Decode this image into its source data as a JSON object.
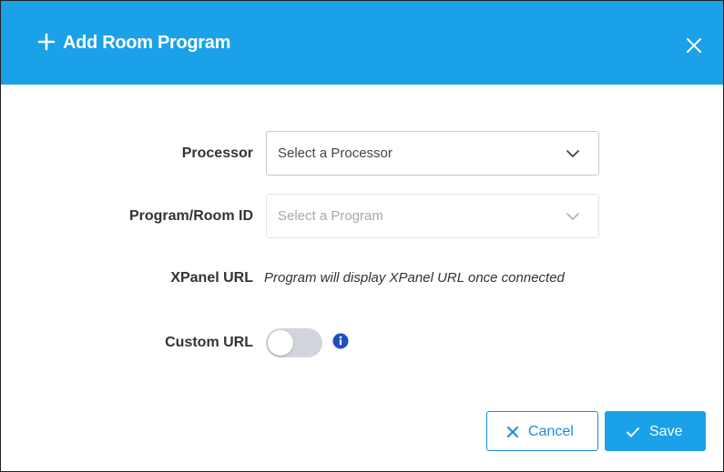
{
  "dialog": {
    "title": "Add Room Program",
    "header_color": "#1aa1e8"
  },
  "form": {
    "processor": {
      "label": "Processor",
      "placeholder": "Select a Processor",
      "disabled": false
    },
    "program": {
      "label": "Program/Room ID",
      "placeholder": "Select a Program",
      "disabled": true
    },
    "xpanel": {
      "label": "XPanel URL",
      "value": "Program will display XPanel URL once connected"
    },
    "custom_url": {
      "label": "Custom URL",
      "enabled": false
    }
  },
  "actions": {
    "cancel_label": "Cancel",
    "save_label": "Save",
    "accent_color": "#1a8cd8"
  },
  "icons": {
    "header": "plus-icon",
    "close": "close-icon",
    "dropdown": "chevron-down-icon",
    "info": "info-icon",
    "cancel": "x-icon",
    "save": "check-icon"
  }
}
